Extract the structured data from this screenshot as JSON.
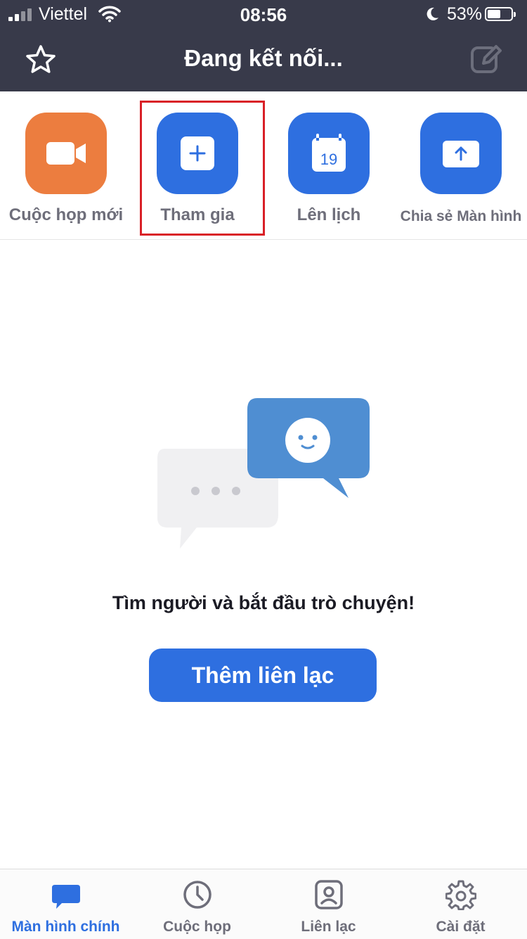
{
  "status_bar": {
    "carrier": "Viettel",
    "time": "08:56",
    "battery_percent": "53%",
    "battery_level": 0.53
  },
  "header": {
    "title": "Đang kết nối...",
    "left_icon": "star-icon",
    "right_icon": "compose-icon",
    "background_color": "#383a4a"
  },
  "actions": [
    {
      "label": "Cuộc họp mới",
      "icon": "video-camera-icon",
      "color": "#ec7d3f"
    },
    {
      "label": "Tham gia",
      "icon": "plus-icon",
      "color": "#2e6fe0",
      "highlighted": true
    },
    {
      "label": "Lên lịch",
      "icon": "calendar-icon",
      "color": "#2e6fe0",
      "calendar_day": "19"
    },
    {
      "label": "Chia sẻ Màn hình",
      "icon": "share-screen-icon",
      "color": "#2e6fe0"
    }
  ],
  "empty_state": {
    "message": "Tìm người và bắt đầu trò chuyện!",
    "button_label": "Thêm liên lạc",
    "illustration": "chat-bubbles-illustration"
  },
  "tab_bar": {
    "active_color": "#2e6fe0",
    "items": [
      {
        "label": "Màn hình chính",
        "icon": "chat-icon",
        "active": true
      },
      {
        "label": "Cuộc họp",
        "icon": "clock-icon",
        "active": false
      },
      {
        "label": "Liên lạc",
        "icon": "contact-icon",
        "active": false
      },
      {
        "label": "Cài đặt",
        "icon": "gear-icon",
        "active": false
      }
    ]
  },
  "highlight_color": "#d92027"
}
